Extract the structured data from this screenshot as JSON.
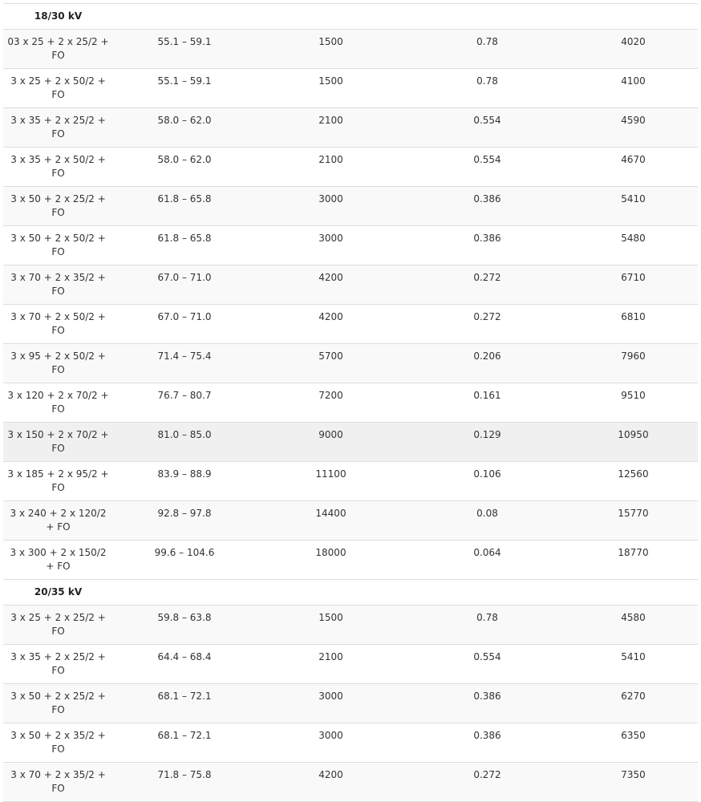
{
  "groups": [
    {
      "label": "18/30 kV",
      "rows": [
        [
          "03 x 25 + 2 x 25/2 + FO",
          "55.1 – 59.1",
          "1500",
          "0.78",
          "4020"
        ],
        [
          "3 x 25 + 2 x 50/2 + FO",
          "55.1 – 59.1",
          "1500",
          "0.78",
          "4100"
        ],
        [
          "3 x 35 + 2 x 25/2 + FO",
          "58.0 – 62.0",
          "2100",
          "0.554",
          "4590"
        ],
        [
          "3 x 35 + 2 x 50/2 + FO",
          "58.0 – 62.0",
          "2100",
          "0.554",
          "4670"
        ],
        [
          "3 x 50 + 2 x 25/2 + FO",
          "61.8 – 65.8",
          "3000",
          "0.386",
          "5410"
        ],
        [
          "3 x 50 + 2 x 50/2 + FO",
          "61.8 – 65.8",
          "3000",
          "0.386",
          "5480"
        ],
        [
          "3 x 70 + 2 x 35/2 + FO",
          "67.0 – 71.0",
          "4200",
          "0.272",
          "6710"
        ],
        [
          "3 x 70 + 2 x 50/2 + FO",
          "67.0 – 71.0",
          "4200",
          "0.272",
          "6810"
        ],
        [
          "3 x 95 + 2 x 50/2 + FO",
          "71.4 – 75.4",
          "5700",
          "0.206",
          "7960"
        ],
        [
          "3 x 120 + 2 x 70/2 + FO",
          "76.7 – 80.7",
          "7200",
          "0.161",
          "9510"
        ],
        [
          "3 x 150 + 2 x 70/2 + FO",
          "81.0 – 85.0",
          "9000",
          "0.129",
          "10950"
        ],
        [
          "3 x 185 + 2 x 95/2 + FO",
          "83.9 – 88.9",
          "11100",
          "0.106",
          "12560"
        ],
        [
          "3 x 240 + 2 x 120/2 + FO",
          "92.8 – 97.8",
          "14400",
          "0.08",
          "15770"
        ],
        [
          "3 x 300 + 2 x 150/2 + FO",
          "99.6 – 104.6",
          "18000",
          "0.064",
          "18770"
        ]
      ]
    },
    {
      "label": "20/35 kV",
      "rows": [
        [
          "3 x 25 + 2 x 25/2 + FO",
          "59.8 – 63.8",
          "1500",
          "0.78",
          "4580"
        ],
        [
          "3 x 35 + 2 x 25/2 + FO",
          "64.4 – 68.4",
          "2100",
          "0.554",
          "5410"
        ],
        [
          "3 x 50 + 2 x 25/2 + FO",
          "68.1 – 72.1",
          "3000",
          "0.386",
          "6270"
        ],
        [
          "3 x 50 + 2 x 35/2 + FO",
          "68.1 – 72.1",
          "3000",
          "0.386",
          "6350"
        ],
        [
          "3 x 70 + 2 x 35/2 + FO",
          "71.8 – 75.8",
          "4200",
          "0.272",
          "7350"
        ]
      ]
    }
  ]
}
